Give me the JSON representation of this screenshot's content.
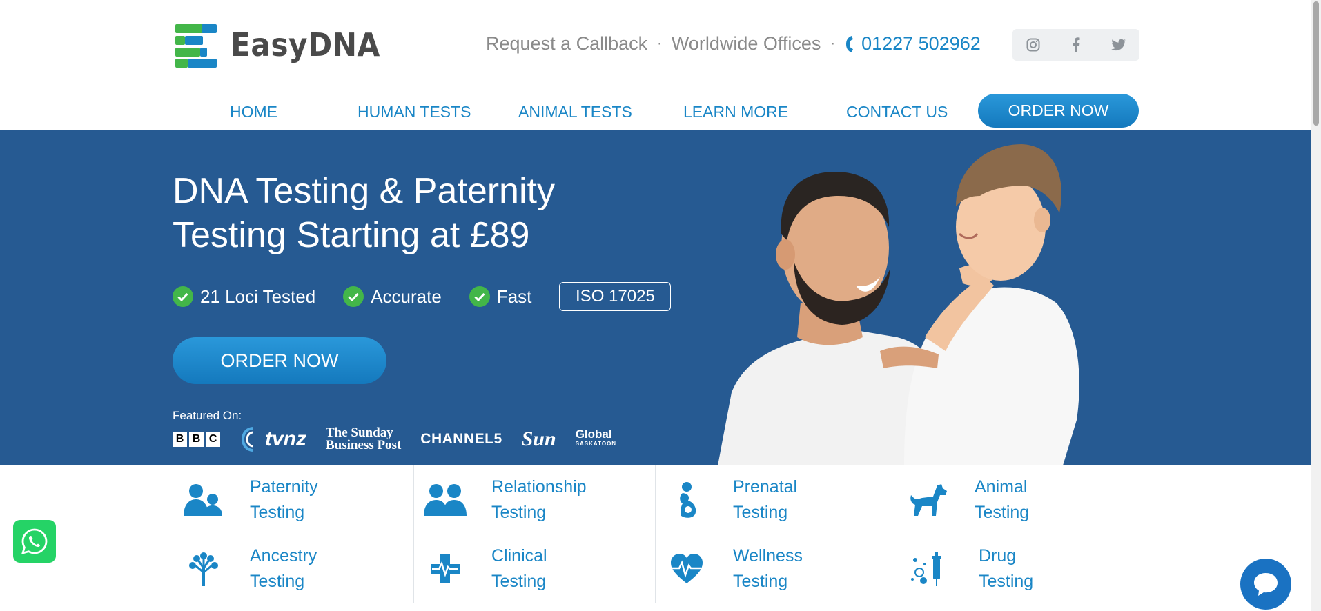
{
  "brand": {
    "name": "EasyDNA",
    "colors": {
      "primary": "#1a86c6",
      "hero_bg": "#265a92",
      "check_green": "#43b649",
      "logo_green": "#43b649",
      "logo_blue": "#1a86c6"
    }
  },
  "header": {
    "links": [
      {
        "label": "Request a Callback"
      },
      {
        "label": "Worldwide Offices"
      }
    ],
    "separator": "·",
    "phone": "01227 502962",
    "social": [
      "instagram-icon",
      "facebook-icon",
      "twitter-icon"
    ]
  },
  "nav": {
    "items": [
      "HOME",
      "HUMAN TESTS",
      "ANIMAL TESTS",
      "LEARN MORE",
      "CONTACT US"
    ],
    "order_label": "ORDER NOW"
  },
  "hero": {
    "title": "DNA Testing & Paternity Testing Starting at £89",
    "features": [
      "21 Loci Tested",
      "Accurate",
      "Fast"
    ],
    "badge": "ISO 17025",
    "cta": "ORDER NOW",
    "featured_label": "Featured On:",
    "media_logos": {
      "bbc": [
        "B",
        "B",
        "C"
      ],
      "tvnz": "tvnz",
      "sbp_line1": "The Sunday",
      "sbp_line2": "Business Post",
      "channel5": "CHANNEL5",
      "sun": "Sun",
      "global": "Global",
      "global_sub": "SASKATOON"
    }
  },
  "categories": [
    {
      "line1": "Paternity",
      "line2": "Testing",
      "icon": "parent-child-icon"
    },
    {
      "line1": "Relationship",
      "line2": "Testing",
      "icon": "people-icon"
    },
    {
      "line1": "Prenatal",
      "line2": "Testing",
      "icon": "pregnant-icon"
    },
    {
      "line1": "Animal",
      "line2": "Testing",
      "icon": "dog-icon"
    },
    {
      "line1": "Ancestry",
      "line2": "Testing",
      "icon": "tree-icon"
    },
    {
      "line1": "Clinical",
      "line2": "Testing",
      "icon": "medical-cross-icon"
    },
    {
      "line1": "Wellness",
      "line2": "Testing",
      "icon": "heartbeat-icon"
    },
    {
      "line1": "Drug",
      "line2": "Testing",
      "icon": "syringe-icon"
    }
  ]
}
